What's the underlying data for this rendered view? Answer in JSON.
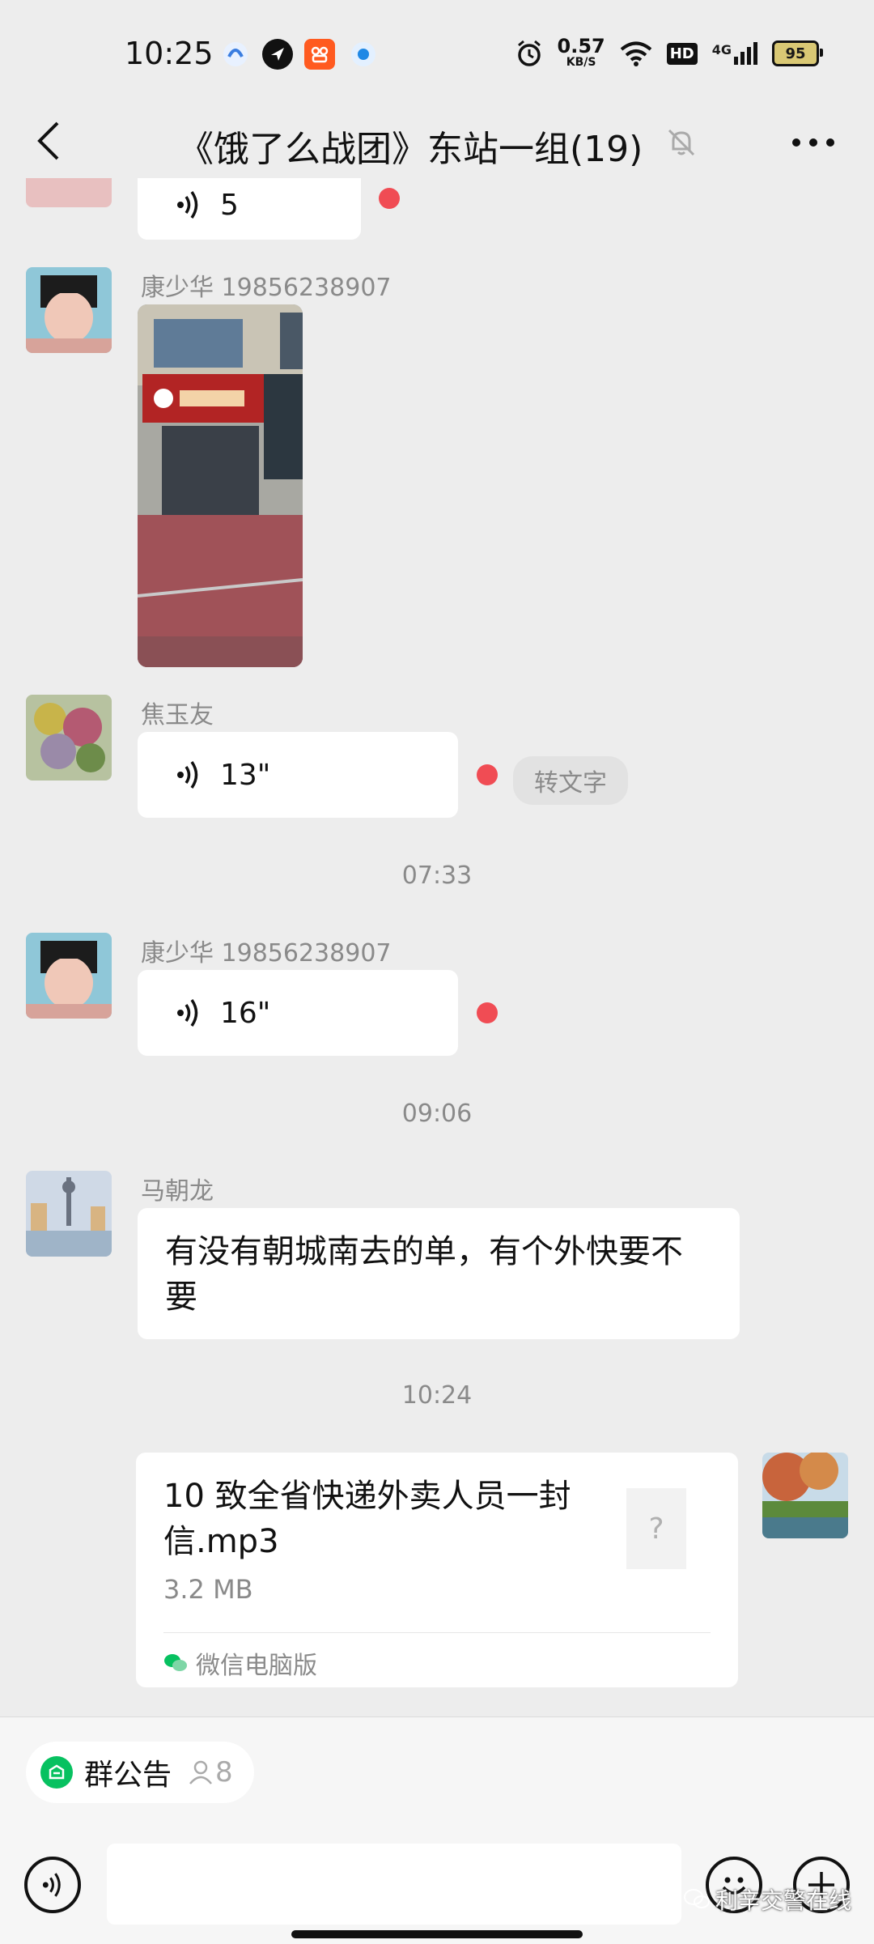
{
  "status_bar": {
    "time": "10:25",
    "net_speed_value": "0.57",
    "net_speed_unit": "KB/S",
    "hd_label": "HD",
    "network_label": "4G",
    "battery": "95"
  },
  "header": {
    "title": "《饿了么战团》东站一组(19)",
    "icons": [
      "back-arrow",
      "mute-bell",
      "more-dots"
    ]
  },
  "messages": [
    {
      "type": "voice",
      "duration": "5",
      "unread": true
    },
    {
      "type": "image",
      "sender": "康少华 19856238907"
    },
    {
      "type": "voice",
      "sender": "焦玉友",
      "duration": "13\"",
      "unread": true,
      "convert_label": "转文字"
    },
    {
      "type": "timestamp",
      "text": "07:33"
    },
    {
      "type": "voice",
      "sender": "康少华 19856238907",
      "duration": "16\"",
      "unread": true
    },
    {
      "type": "timestamp",
      "text": "09:06"
    },
    {
      "type": "text",
      "sender": "马朝龙",
      "text": "有没有朝城南去的单，有个外快要不要"
    },
    {
      "type": "timestamp",
      "text": "10:24"
    },
    {
      "type": "file",
      "self": true,
      "file_name": "10 致全省快递外卖人员一封信.mp3",
      "file_size": "3.2 MB",
      "source": "微信电脑版",
      "file_icon": "?"
    }
  ],
  "bottom_bar": {
    "notice_label": "群公告",
    "member_count": "8",
    "input_value": "",
    "icons": [
      "voice-input",
      "emoji",
      "plus"
    ]
  },
  "watermark": "利辛交警在线",
  "colors": {
    "background": "#ededed",
    "bubble": "#ffffff",
    "unread_dot": "#f04c54",
    "notice_icon": "#07c160"
  }
}
